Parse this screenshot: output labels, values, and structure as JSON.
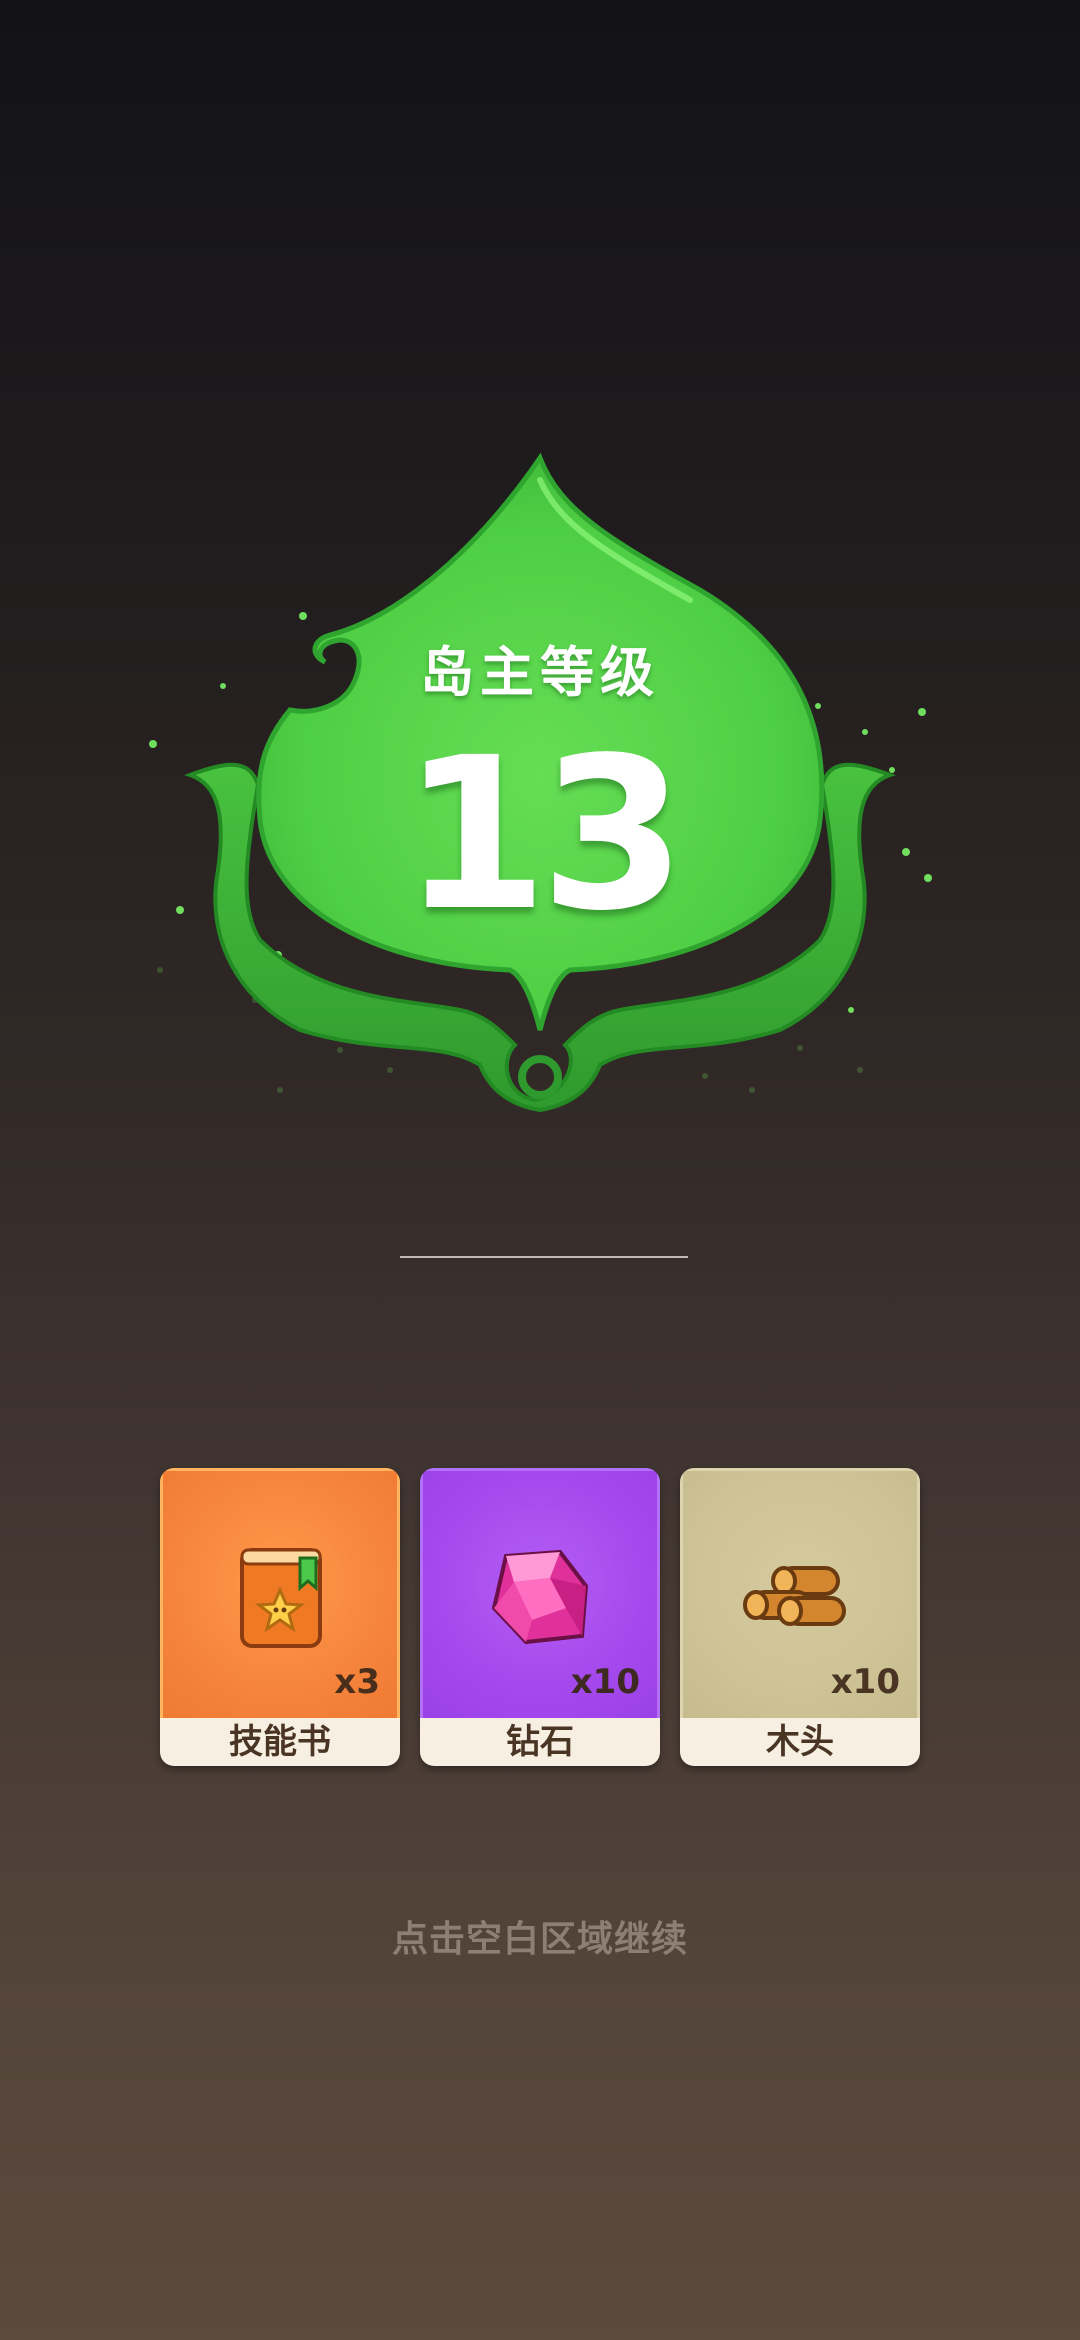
{
  "badge": {
    "title": "岛主等级",
    "level": "13",
    "color": "#4fcf45"
  },
  "rewards": [
    {
      "name": "技能书",
      "count": "x3",
      "icon": "skill-book-icon",
      "color": "#f6843c"
    },
    {
      "name": "钻石",
      "count": "x10",
      "icon": "diamond-icon",
      "color": "#a449ec"
    },
    {
      "name": "木头",
      "count": "x10",
      "icon": "wood-logs-icon",
      "color": "#cdc396"
    }
  ],
  "hint": "点击空白区域继续"
}
